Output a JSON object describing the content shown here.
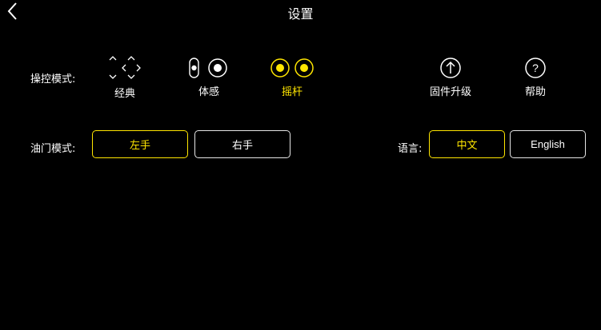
{
  "header": {
    "title": "设置"
  },
  "control_mode": {
    "label": "操控模式:",
    "items": [
      {
        "label": "经典",
        "icon": "dpad-arrows-icon",
        "active": false
      },
      {
        "label": "体感",
        "icon": "toggle-switch-icon",
        "active": false
      },
      {
        "label": "摇杆",
        "icon": "dual-joystick-icon",
        "active": true
      }
    ]
  },
  "firmware": {
    "label": "固件升级",
    "icon": "upload-arrow-icon"
  },
  "help": {
    "label": "帮助",
    "icon": "question-mark-icon"
  },
  "throttle_mode": {
    "label": "油门模式:",
    "options": [
      {
        "label": "左手",
        "active": true
      },
      {
        "label": "右手",
        "active": false
      }
    ]
  },
  "language": {
    "label": "语言:",
    "options": [
      {
        "label": "中文",
        "active": true
      },
      {
        "label": "English",
        "active": false
      }
    ]
  },
  "colors": {
    "background": "#000000",
    "accent": "#ffe600",
    "foreground": "#ffffff"
  }
}
